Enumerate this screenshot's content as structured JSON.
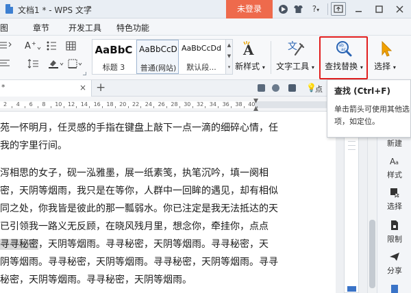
{
  "window": {
    "title": "文档1 * - WPS 文字",
    "login_label": "未登录",
    "question_label": "?"
  },
  "menu": {
    "items": [
      "图",
      "章节",
      "开发工具",
      "特色功能"
    ]
  },
  "ribbon": {
    "styles": [
      {
        "sample": "AaBbC",
        "label": "标题 3"
      },
      {
        "sample": "AaBbCcD",
        "label": "普通(网站)"
      },
      {
        "sample": "AaBbCcDd",
        "label": "默认段..."
      }
    ],
    "new_style_label": "新样式",
    "text_tools_label": "文字工具",
    "find_replace_label": "查找替换",
    "select_label": "选择"
  },
  "tabs": {
    "active_tab_fragment": "*",
    "close_glyph": "×",
    "add_glyph": "+",
    "lamp_label": "点"
  },
  "ruler": {
    "numbers": [
      "2",
      "4",
      "6",
      "8",
      "10",
      "12",
      "14",
      "16",
      "18",
      "20",
      "22",
      "24",
      "26",
      "28",
      "30",
      "32",
      "34",
      "36",
      "38",
      "40"
    ]
  },
  "document": {
    "lines": [
      "苑一怀明月，任灵感的手指在键盘上敲下一点一滴的细碎心情，任",
      "我的字里行间。",
      "",
      "泻相思的女子，砚一泓雅墨，展一纸素笺，执笔沉吟，填一阕相",
      "密，天阴等烟雨，我只是在等你，人群中一回眸的遇见，却有相似",
      "同之处，你我皆是彼此的那一瓢弱水。你已注定是我无法抵达的天",
      "  已引领我一路义无反顾，在晓风残月里，想念你，牵挂你，点点",
      "寻寻秘密，天阴等烟雨。寻寻秘密，天阴等烟雨。寻寻秘密，天",
      "阴等烟雨。寻寻秘密，天阴等烟雨。寻寻秘密，天阴等烟雨。寻寻",
      "秘密，天阴等烟雨。寻寻秘密，天阴等烟雨。"
    ],
    "highlight_text": "寻寻秘密"
  },
  "right_pane": {
    "items": [
      "新建",
      "样式",
      "选择",
      "限制",
      "分享"
    ]
  },
  "tooltip": {
    "title": "查找 (Ctrl+F)",
    "desc_line1": "单击箭头可使用其他选",
    "desc_line2": "项，如定位。"
  },
  "colors": {
    "accent": "#ee6a4c",
    "highlight_box": "#e11d1d",
    "brand_blue": "#3a73c7"
  }
}
